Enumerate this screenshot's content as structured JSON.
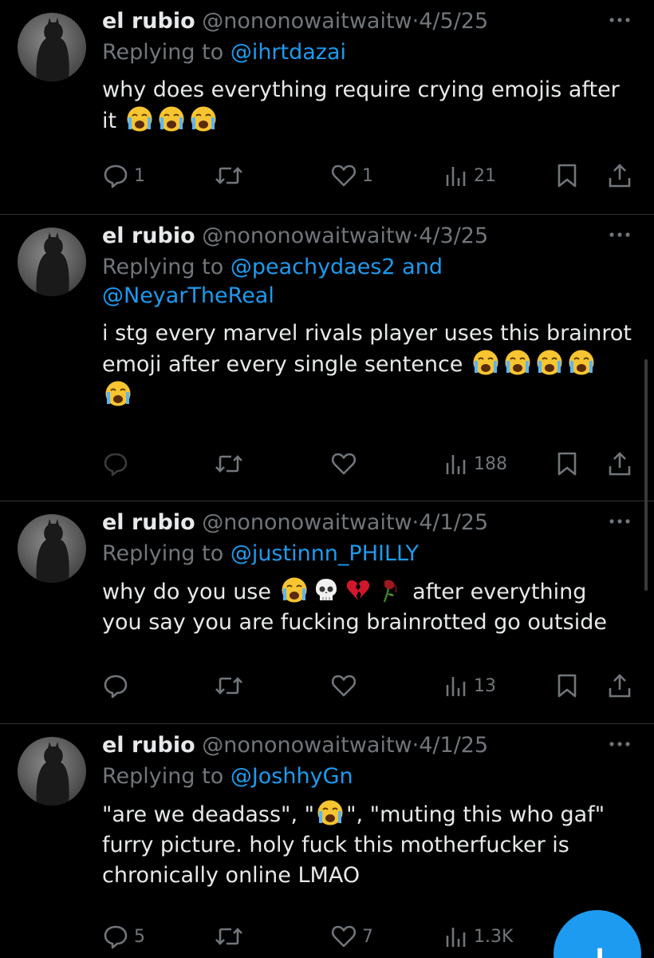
{
  "tweets": [
    {
      "name": "el rubio",
      "handle": "@nononowaitwaitw",
      "sep": "·",
      "date": "4/5/25",
      "replying_prefix": "Replying to ",
      "mentions": [
        "@ihrtdazai"
      ],
      "mention_joiner": "",
      "text_parts": [
        "why does everything require crying emojis after it "
      ],
      "emojis_text": [
        "crying-face",
        "crying-face",
        "crying-face"
      ],
      "stats": {
        "replies": "1",
        "reposts": "",
        "likes": "1",
        "views": "21"
      }
    },
    {
      "name": "el rubio",
      "handle": "@nononowaitwaitw",
      "sep": "·",
      "date": "4/3/25",
      "replying_prefix": "Replying to ",
      "mentions": [
        "@peachydaes2",
        "@NeyarTheReal"
      ],
      "mention_joiner": " and",
      "text_parts": [
        "i stg every marvel rivals player uses this brainrot emoji after every single sentence "
      ],
      "emojis_text": [
        "crying-face",
        "crying-face",
        "crying-face",
        "crying-face",
        "crying-face"
      ],
      "stats": {
        "replies": "",
        "reposts": "",
        "likes": "",
        "views": "188"
      }
    },
    {
      "name": "el rubio",
      "handle": "@nononowaitwaitw",
      "sep": "·",
      "date": "4/1/25",
      "replying_prefix": "Replying to ",
      "mentions": [
        "@justinnn_PHILLY"
      ],
      "mention_joiner": "",
      "text_parts": [
        "why do you use ",
        " after everything you say you are fucking brainrotted go outside"
      ],
      "emojis_text": [
        "crying-face",
        "skull",
        "broken-heart",
        "wilted-rose"
      ],
      "stats": {
        "replies": "",
        "reposts": "",
        "likes": "",
        "views": "13"
      }
    },
    {
      "name": "el rubio",
      "handle": "@nononowaitwaitw",
      "sep": "·",
      "date": "4/1/25",
      "replying_prefix": "Replying to ",
      "mentions": [
        "@JoshhyGn"
      ],
      "mention_joiner": "",
      "text_parts": [
        "\"are we deadass\", \"",
        "\", \"muting this who gaf\" furry picture. holy fuck this motherfucker is chronically online LMAO"
      ],
      "emojis_text": [
        "crying-face"
      ],
      "stats": {
        "replies": "5",
        "reposts": "",
        "likes": "7",
        "views": "1.3K"
      }
    }
  ],
  "fab": {
    "label": "+"
  },
  "colors": {
    "accent": "#1d9bf0",
    "muted": "#71767b",
    "text": "#e7e9ea",
    "divider": "#2f3336"
  }
}
